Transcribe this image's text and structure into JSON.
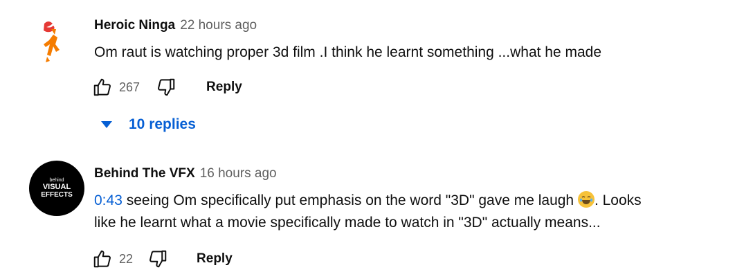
{
  "comments": [
    {
      "author": "Heroic Ninga",
      "time": "22 hours ago",
      "text": "Om raut is watching proper 3d film .I think he learnt something ...what he made",
      "likes": "267",
      "reply_label": "Reply",
      "replies_label": "10 replies",
      "avatar_icon": "ninja-orange-icon"
    },
    {
      "author": "Behind The VFX",
      "time": "16 hours ago",
      "timestamp": "0:43",
      "text_line1": " seeing Om specifically put emphasis on the word \"3D\" gave me laugh ",
      "text_line1_end": ". Looks",
      "text_line2": "like he learnt what a movie specifically made to watch in \"3D\" actually means...",
      "emoji": "😂",
      "likes": "22",
      "reply_label": "Reply",
      "avatar_text": [
        "behind",
        "VISUAL",
        "EFFECTS"
      ],
      "avatar_icon": "behind-visual-effects-logo"
    }
  ],
  "colors": {
    "link": "#065fd4",
    "muted": "#606060",
    "text": "#0f0f0f"
  }
}
